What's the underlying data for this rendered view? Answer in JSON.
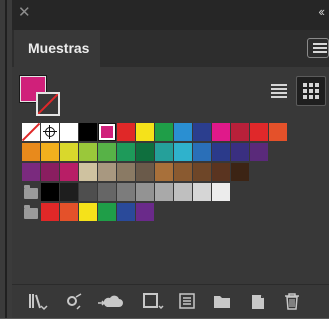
{
  "panel": {
    "close_glyph": "✕",
    "collapse_glyph": "‹‹",
    "tab_label": "Muestras"
  },
  "fill_stroke": {
    "fill_color": "#d0207a",
    "stroke": "none"
  },
  "view_modes": [
    "list-view-icon",
    "thumbnail-view-icon"
  ],
  "active_view": "thumbnail",
  "swatch_rows": [
    [
      "none",
      "registration",
      "#ffffff",
      "#000000",
      "#d0207a",
      "#e02828",
      "#f5e21a",
      "#1f9e48",
      "#2a8fd2",
      "#2b3e8e",
      "#e0198a",
      "#b8203a",
      "#e0282a",
      "#e4512a"
    ],
    [
      "#e88a1c",
      "#f2b01e",
      "#d9d82c",
      "#9ac83a",
      "#57b247",
      "#1e9a5a",
      "#0f6f3e",
      "#25a09a",
      "#2fb2cc",
      "#2a6fb8",
      "#2b3a8a",
      "#3a2f80",
      "#5a2a7a"
    ],
    [
      "#7a2a7e",
      "#8a1e60",
      "#b81e66",
      "#cfc2a0",
      "#a89880",
      "#8a7a64",
      "#6a5a4a",
      "#a8703a",
      "#8a5a30",
      "#6e4628",
      "#5a3420",
      "#3c2414"
    ],
    [
      "group-folder",
      "#000000",
      "#1e1e1e",
      "#4e4e4e",
      "#666666",
      "#7c7c7c",
      "#939393",
      "#a9a9a9",
      "#bfbfbf",
      "#d6d6d6",
      "#ececec"
    ],
    [
      "group-folder",
      "#e02828",
      "#e4512a",
      "#f5e21a",
      "#1f9e48",
      "#2a4a9a",
      "#6a2a8a"
    ]
  ],
  "selected_swatch": "#d0207a",
  "bottom_toolbar": [
    "swatch-libraries-icon",
    "place-swatches-icon",
    "cloud-library-icon",
    "show-swatch-kinds-icon",
    "swatch-options-icon",
    "new-color-group-icon",
    "new-swatch-icon",
    "delete-swatch-icon"
  ]
}
